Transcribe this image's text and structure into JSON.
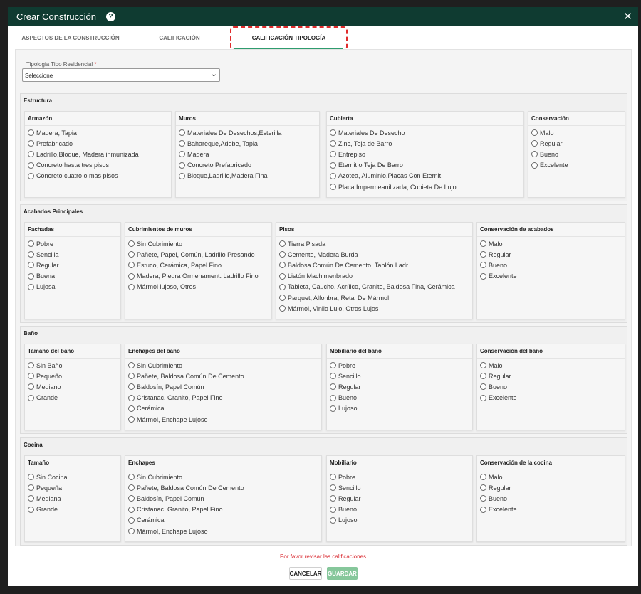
{
  "modal": {
    "title": "Crear Construcción",
    "help_icon": "?",
    "close_icon": "✕"
  },
  "tabs": [
    {
      "label": "ASPECTOS DE LA CONSTRUCCIÓN"
    },
    {
      "label": "CALIFICACIÓN"
    },
    {
      "label": "CALIFICACIÓN TIPOLOGÍA"
    }
  ],
  "tipologia": {
    "label": "Tipologia Tipo Residencial",
    "required_mark": "*",
    "value": "Seleccione"
  },
  "sections": [
    {
      "title": "Estructura",
      "groups": [
        {
          "title": "Armazón",
          "options": [
            "Madera, Tapia",
            "Prefabricado",
            "Ladrillo,Bloque, Madera inmunizada",
            "Concreto hasta tres pisos",
            "Concreto cuatro o mas pisos"
          ]
        },
        {
          "title": "Muros",
          "options": [
            "Materiales De Desechos,Esterilla",
            "Bahareque,Adobe, Tapia",
            "Madera",
            "Concreto Prefabricado",
            "Bloque,Ladrillo,Madera Fina"
          ]
        },
        {
          "title": "Cubierta",
          "options": [
            "Materiales De Desecho",
            "Zinc, Teja de Barro",
            "Entrepiso",
            "Eternit o Teja De Barro",
            "Azotea, Aluminio,Placas Con Eternit",
            "Placa Impermeanilizada, Cubieta De Lujo"
          ]
        },
        {
          "title": "Conservación",
          "options": [
            "Malo",
            "Regular",
            "Bueno",
            "Excelente"
          ]
        }
      ]
    },
    {
      "title": "Acabados Principales",
      "groups": [
        {
          "title": "Fachadas",
          "options": [
            "Pobre",
            "Sencilla",
            "Regular",
            "Buena",
            "Lujosa"
          ]
        },
        {
          "title": "Cubrimientos de muros",
          "options": [
            "Sin Cubrimiento",
            "Pañete, Papel, Común, Ladrillo Presando",
            "Estuco, Cerámica, Papel Fino",
            "Madera, Piedra Ormenament. Ladrillo Fino",
            "Mármol lujoso, Otros"
          ]
        },
        {
          "title": "Pisos",
          "options": [
            "Tierra Pisada",
            "Cemento, Madera Burda",
            "Baldosa Común De Cemento, Tablón Ladr",
            "Listón Machimenbrado",
            "Tableta, Caucho, Acrílico, Granito, Baldosa Fina, Cerámica",
            "Parquet, Alfonbra, Retal De Mármol",
            "Mármol, Vinilo Lujo, Otros Lujos"
          ]
        },
        {
          "title": "Conservación de acabados",
          "options": [
            "Malo",
            "Regular",
            "Bueno",
            "Excelente"
          ]
        }
      ]
    },
    {
      "title": "Baño",
      "groups": [
        {
          "title": "Tamaño del baño",
          "options": [
            "Sin Baño",
            "Pequeño",
            "Mediano",
            "Grande"
          ]
        },
        {
          "title": "Enchapes del baño",
          "options": [
            "Sin Cubrimiento",
            "Pañete, Baldosa Común De Cemento",
            "Baldosín, Papel Común",
            "Cristanac. Granito, Papel Fino",
            "Cerámica",
            "Mármol, Enchape Lujoso"
          ]
        },
        {
          "title": "Mobiliario del baño",
          "options": [
            "Pobre",
            "Sencillo",
            "Regular",
            "Bueno",
            "Lujoso"
          ]
        },
        {
          "title": "Conservación del baño",
          "options": [
            "Malo",
            "Regular",
            "Bueno",
            "Excelente"
          ]
        }
      ]
    },
    {
      "title": "Cocina",
      "groups": [
        {
          "title": "Tamaño",
          "options": [
            "Sin Cocina",
            "Pequeña",
            "Mediana",
            "Grande"
          ]
        },
        {
          "title": "Enchapes",
          "options": [
            "Sin Cubrimiento",
            "Pañete, Baldosa Común De Cemento",
            "Baldosín, Papel Común",
            "Cristanac. Granito, Papel Fino",
            "Cerámica",
            "Mármol, Enchape Lujoso"
          ]
        },
        {
          "title": "Mobiliario",
          "options": [
            "Pobre",
            "Sencillo",
            "Regular",
            "Bueno",
            "Lujoso"
          ]
        },
        {
          "title": "Conservación de la cocina",
          "options": [
            "Malo",
            "Regular",
            "Bueno",
            "Excelente"
          ]
        }
      ]
    }
  ],
  "footer": {
    "error": "Por favor revisar las calificaciones",
    "cancel_label": "CANCELAR",
    "save_label": "GUARDAR"
  }
}
